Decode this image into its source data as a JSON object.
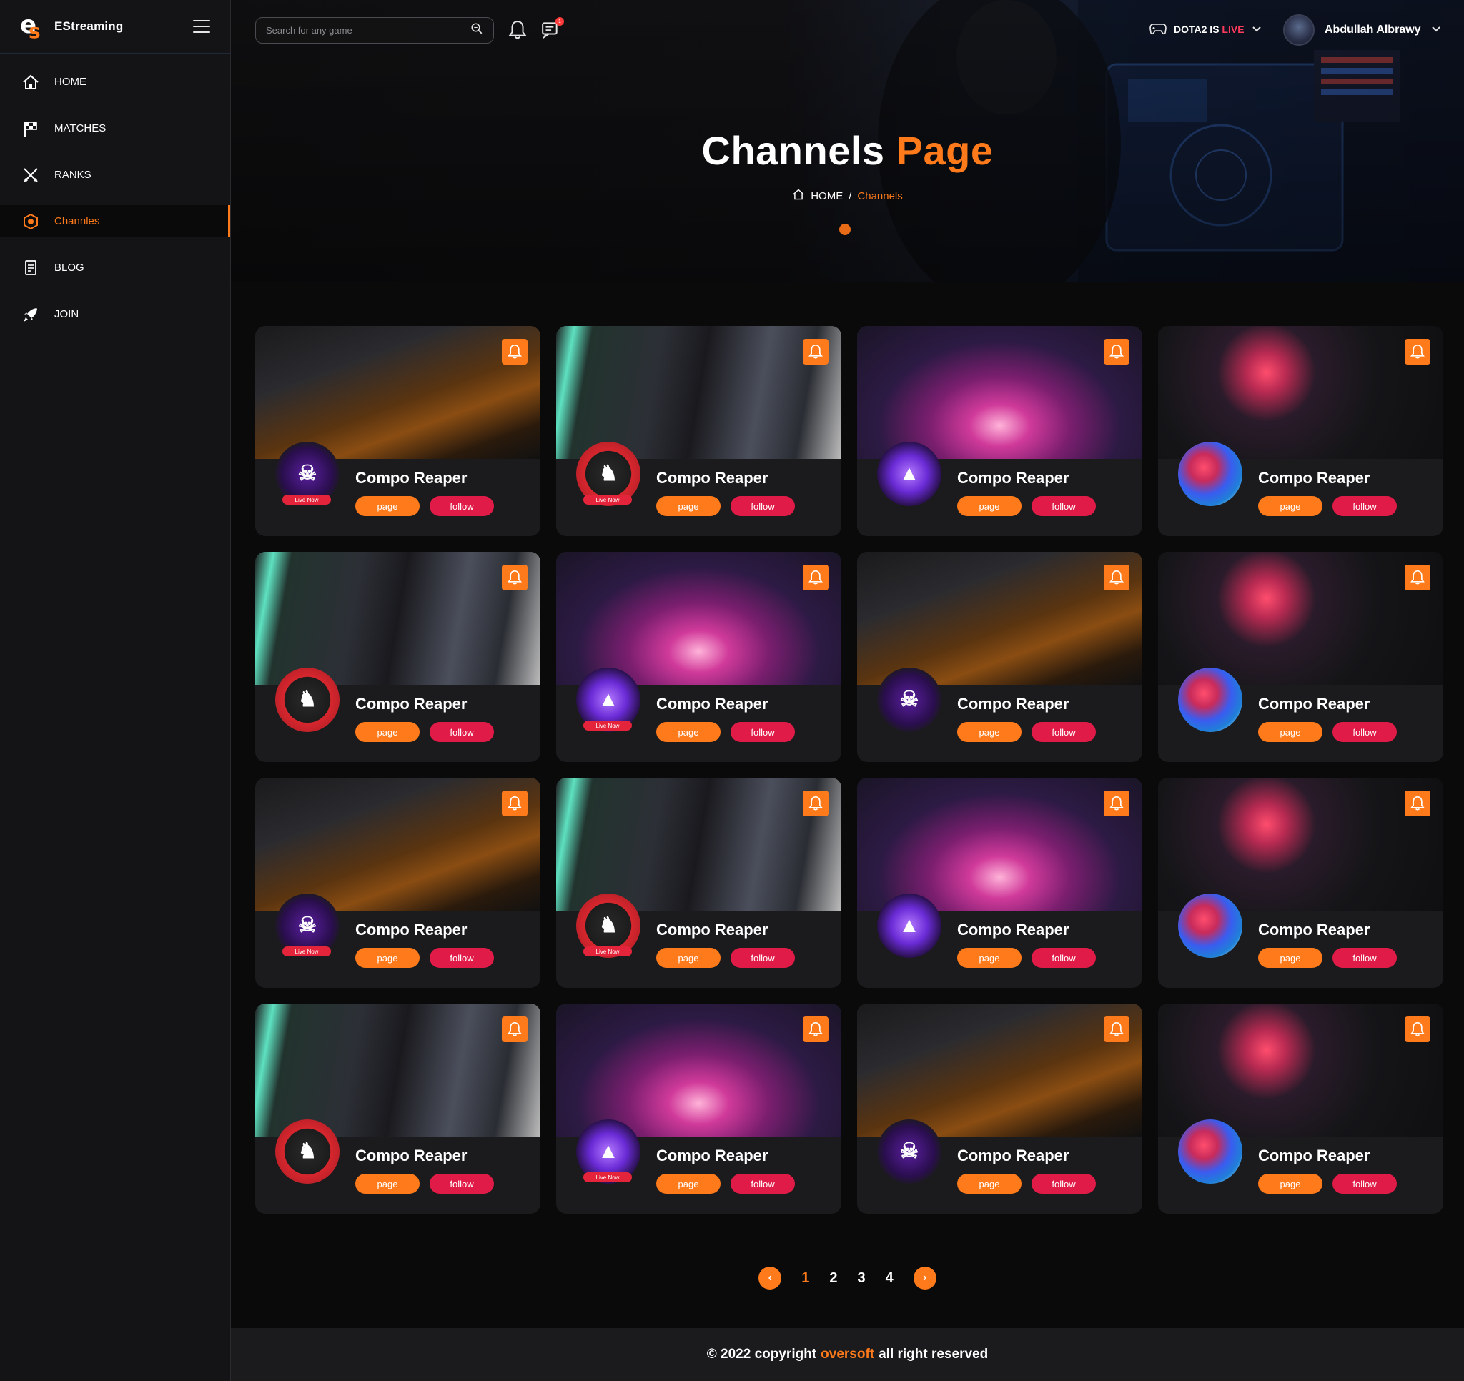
{
  "brand": {
    "name": "EStreaming"
  },
  "sidebar": {
    "items": [
      {
        "label": "HOME",
        "icon": "home-icon",
        "active": false
      },
      {
        "label": "MATCHES",
        "icon": "flag-icon",
        "active": false
      },
      {
        "label": "RANKS",
        "icon": "crossed-swords-icon",
        "active": false
      },
      {
        "label": "Channles",
        "icon": "channels-icon",
        "active": true
      },
      {
        "label": "BLOG",
        "icon": "document-icon",
        "active": false
      },
      {
        "label": "JOIN",
        "icon": "rocket-icon",
        "active": false
      }
    ]
  },
  "header": {
    "search_placeholder": "Search for any game",
    "chat_badge": "1",
    "live_prefix": "DOTA2 IS",
    "live_word": "LIVE",
    "user_name": "Abdullah Albrawy"
  },
  "hero": {
    "title_main": "Channels",
    "title_accent": "Page",
    "breadcrumb_home": "HOME",
    "breadcrumb_sep": "/",
    "breadcrumb_current": "Channels"
  },
  "cards": [
    {
      "title": "Compo Reaper",
      "page_label": "page",
      "follow_label": "follow",
      "thumb": "desk",
      "logo": "skull",
      "live": "Live Now"
    },
    {
      "title": "Compo Reaper",
      "page_label": "page",
      "follow_label": "follow",
      "thumb": "cam",
      "logo": "gaming",
      "live": "Live Now"
    },
    {
      "title": "Compo Reaper",
      "page_label": "page",
      "follow_label": "follow",
      "thumb": "arena",
      "logo": "tri",
      "live": ""
    },
    {
      "title": "Compo Reaper",
      "page_label": "page",
      "follow_label": "follow",
      "thumb": "dark",
      "logo": "smoke",
      "live": ""
    },
    {
      "title": "Compo Reaper",
      "page_label": "page",
      "follow_label": "follow",
      "thumb": "cam",
      "logo": "gaming",
      "live": ""
    },
    {
      "title": "Compo Reaper",
      "page_label": "page",
      "follow_label": "follow",
      "thumb": "arena",
      "logo": "tri",
      "live": "Live Now"
    },
    {
      "title": "Compo Reaper",
      "page_label": "page",
      "follow_label": "follow",
      "thumb": "desk",
      "logo": "skull",
      "live": ""
    },
    {
      "title": "Compo Reaper",
      "page_label": "page",
      "follow_label": "follow",
      "thumb": "dark",
      "logo": "smoke",
      "live": ""
    },
    {
      "title": "Compo Reaper",
      "page_label": "page",
      "follow_label": "follow",
      "thumb": "desk",
      "logo": "skull",
      "live": "Live Now"
    },
    {
      "title": "Compo Reaper",
      "page_label": "page",
      "follow_label": "follow",
      "thumb": "cam",
      "logo": "gaming",
      "live": "Live Now"
    },
    {
      "title": "Compo Reaper",
      "page_label": "page",
      "follow_label": "follow",
      "thumb": "arena",
      "logo": "tri",
      "live": ""
    },
    {
      "title": "Compo Reaper",
      "page_label": "page",
      "follow_label": "follow",
      "thumb": "dark",
      "logo": "smoke",
      "live": ""
    },
    {
      "title": "Compo Reaper",
      "page_label": "page",
      "follow_label": "follow",
      "thumb": "cam",
      "logo": "gaming",
      "live": ""
    },
    {
      "title": "Compo Reaper",
      "page_label": "page",
      "follow_label": "follow",
      "thumb": "arena",
      "logo": "tri",
      "live": "Live Now"
    },
    {
      "title": "Compo Reaper",
      "page_label": "page",
      "follow_label": "follow",
      "thumb": "desk",
      "logo": "skull",
      "live": ""
    },
    {
      "title": "Compo Reaper",
      "page_label": "page",
      "follow_label": "follow",
      "thumb": "dark",
      "logo": "smoke",
      "live": ""
    }
  ],
  "pagination": {
    "pages": [
      "1",
      "2",
      "3",
      "4"
    ],
    "current": "1",
    "prev_glyph": "‹",
    "next_glyph": "›"
  },
  "footer": {
    "prefix": "© 2022 copyright",
    "company": "oversoft",
    "suffix": "all right reserved"
  },
  "colors": {
    "accent": "#ff7a1a",
    "follow": "#e11b47",
    "live": "#ff3b5c",
    "background": "#0a0a0b",
    "card": "#1b1b1d"
  }
}
